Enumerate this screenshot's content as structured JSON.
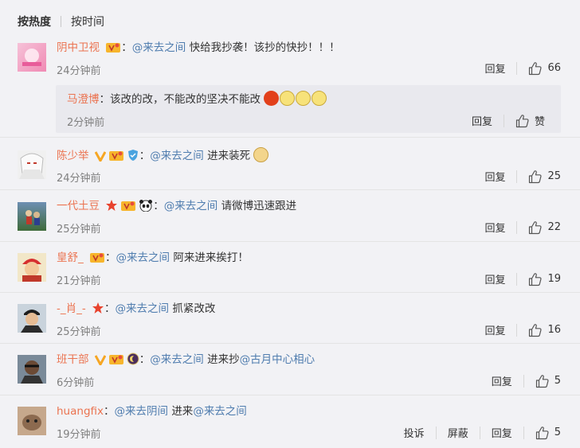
{
  "tabs": {
    "hot": "按热度",
    "time": "按时间"
  },
  "actions": {
    "reply": "回复",
    "report": "投诉",
    "block": "屏蔽",
    "like": "赞"
  },
  "comments": [
    {
      "user": "阴中卫视",
      "mention": "@来去之间",
      "text": "快给我抄袭！该抄的快抄！！！",
      "time": "24分钟前",
      "likes": "66"
    },
    {
      "user": "陈少举",
      "mention": "@来去之间",
      "text": "进来装死",
      "time": "24分钟前",
      "likes": "25"
    },
    {
      "user": "一代土豆",
      "mention": "@来去之间",
      "text": "请微博迅速跟进",
      "time": "25分钟前",
      "likes": "22"
    },
    {
      "user": "皇舒_",
      "mention": "@来去之间",
      "text": "阿来进来挨打！",
      "time": "21分钟前",
      "likes": "19"
    },
    {
      "user": "-_肖_-",
      "mention": "@来去之间",
      "text": "抓紧改改",
      "time": "25分钟前",
      "likes": "16"
    },
    {
      "user": "班干部",
      "mention": "@来去之间",
      "text": "进来抄",
      "mention2": "@古月中心相心",
      "time": "6分钟前",
      "likes": "5"
    },
    {
      "user": "huangfix",
      "mention": "@来去阴间",
      "text": "进来",
      "mention2": "@来去之间",
      "time": "19分钟前",
      "likes": "5"
    }
  ],
  "sub_reply": {
    "user": "马澄博",
    "text": "该改的改，不能改的坚决不能改",
    "time": "2分钟前"
  },
  "colors": {
    "username": "#eb7350",
    "mention": "#507daf",
    "background": "#f2f2f5"
  }
}
